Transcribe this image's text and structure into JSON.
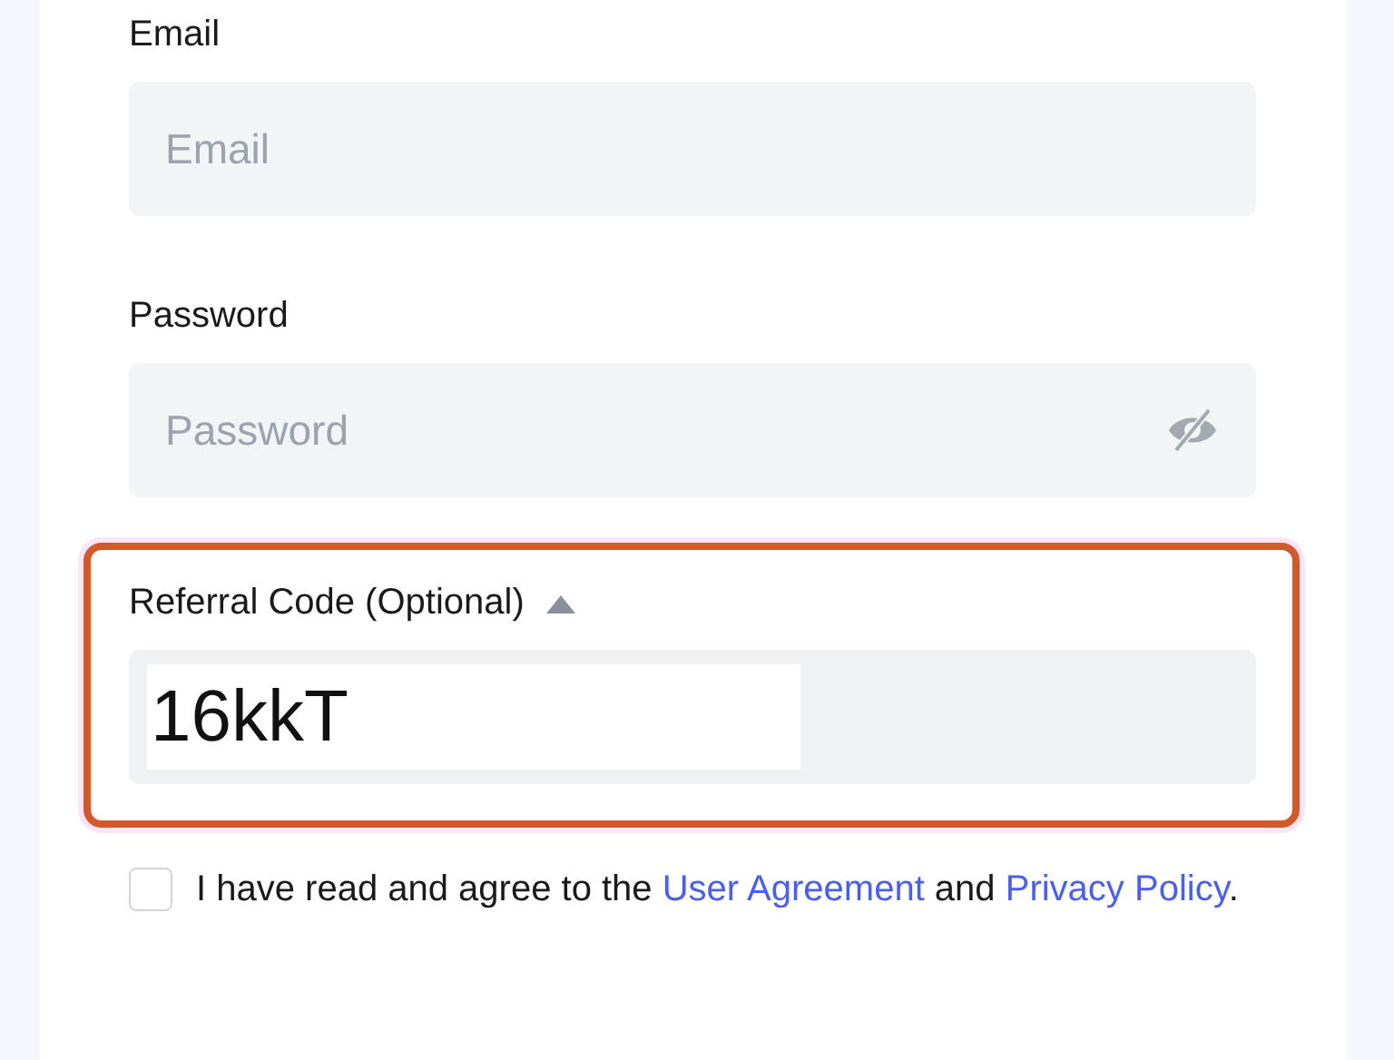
{
  "fields": [
    {
      "kind": "text",
      "label": "Email",
      "placeholder": "Email"
    },
    {
      "kind": "password",
      "label": "Password",
      "placeholder": "Password"
    }
  ],
  "referral": {
    "label": "Referral Code (Optional)",
    "expanded": true,
    "value": "16kkT",
    "highlighted": true
  },
  "agreement": {
    "checked": false,
    "parts": [
      {
        "kind": "text",
        "text": "I have read and agree to the "
      },
      {
        "kind": "link",
        "text": "User Agreement"
      },
      {
        "kind": "text",
        "text": " and "
      },
      {
        "kind": "link",
        "text": "Privacy Policy"
      },
      {
        "kind": "text",
        "text": "."
      }
    ]
  }
}
